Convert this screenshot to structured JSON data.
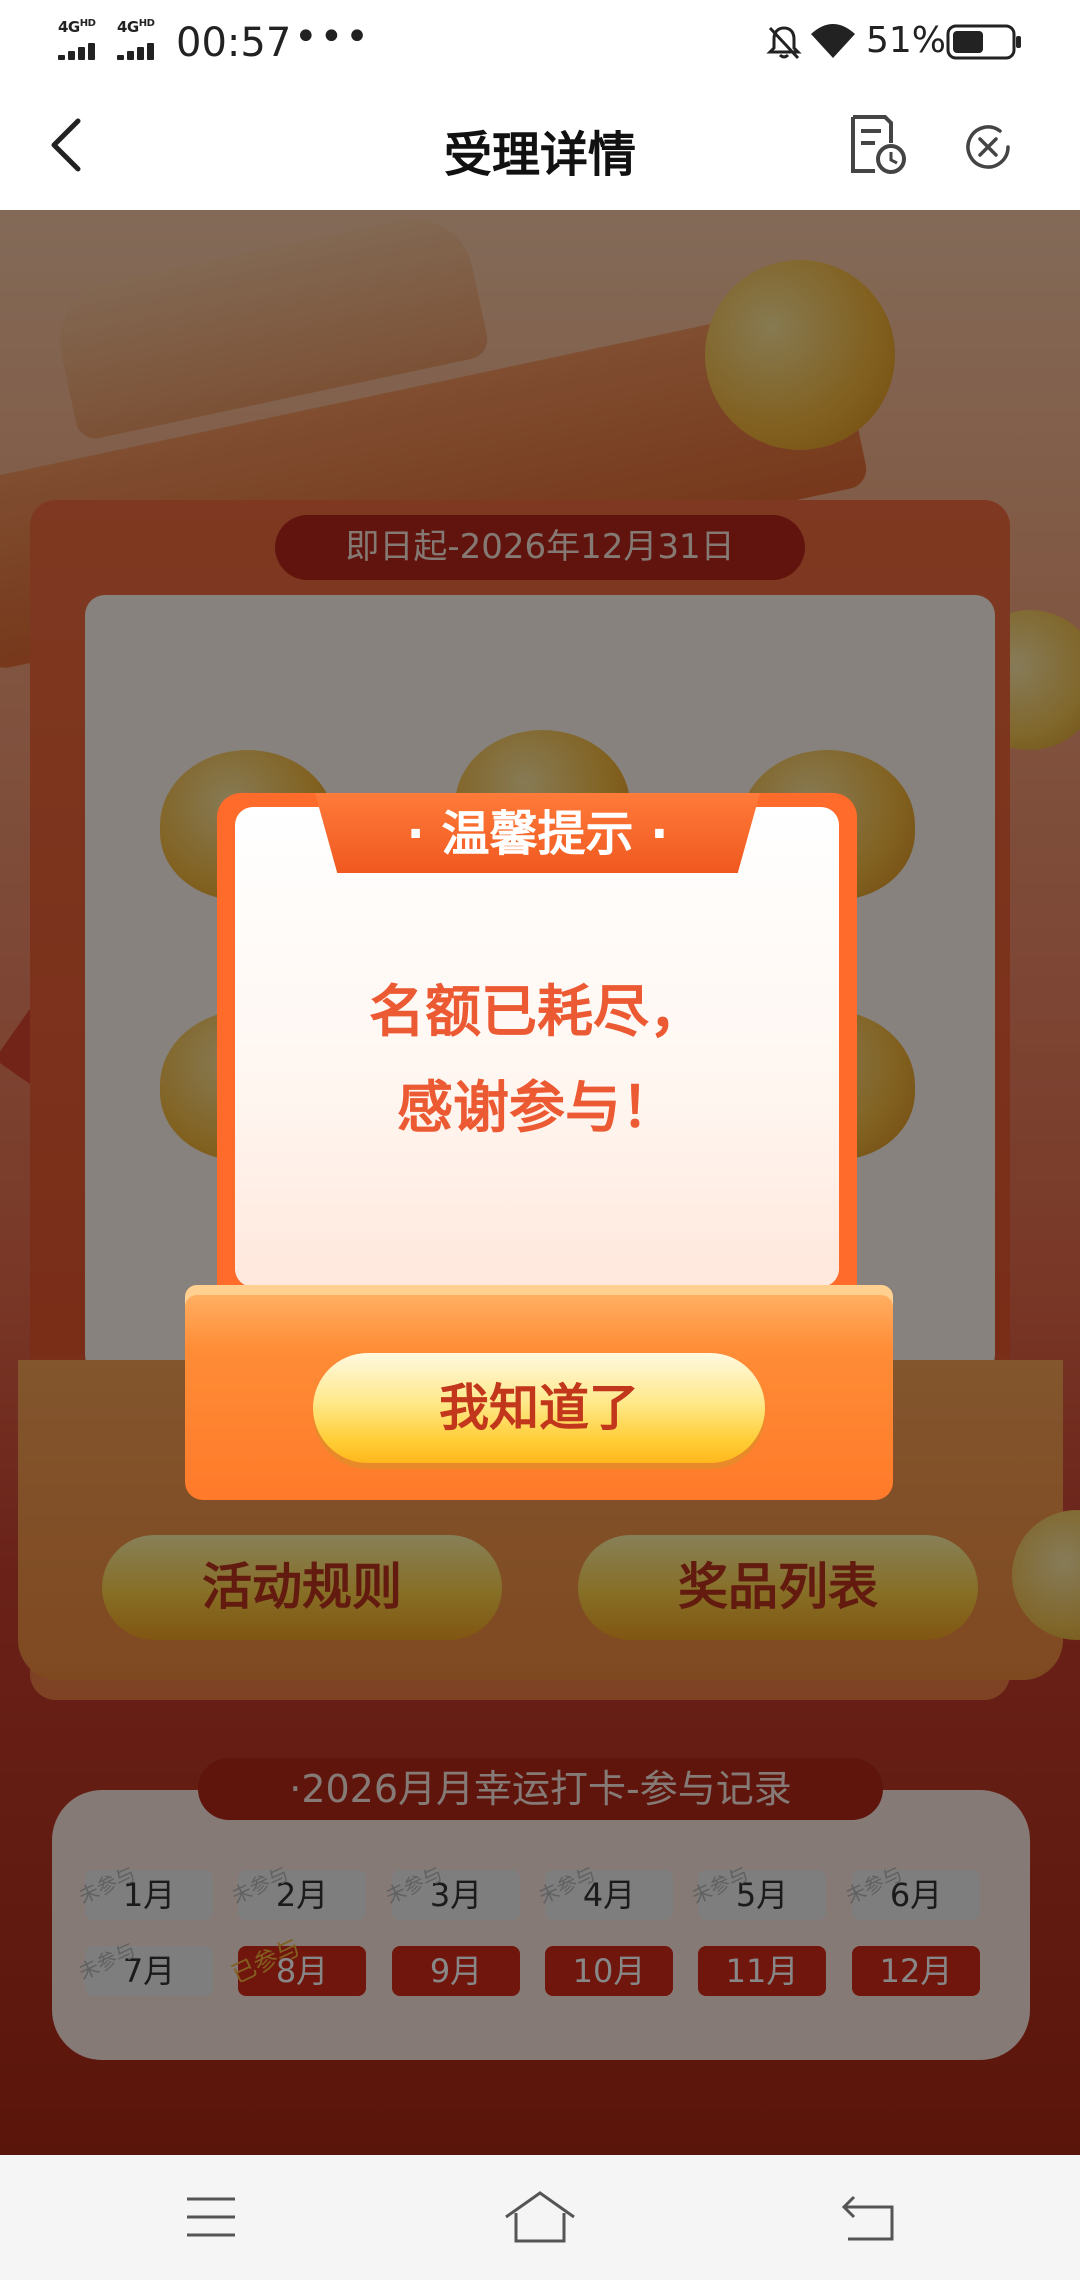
{
  "status_bar": {
    "signal_1": "4G",
    "signal_1_sup": "HD",
    "signal_2": "4G",
    "signal_2_sup": "HD",
    "time": "00:57",
    "more": "•••",
    "battery": "51%",
    "icons": [
      "mute-bell-icon",
      "wifi-icon",
      "battery-icon"
    ]
  },
  "nav": {
    "title": "受理详情",
    "icons": [
      "back-arrow-icon",
      "record-icon",
      "close-icon"
    ]
  },
  "activity": {
    "date_range": "即日起-2026年12月31日",
    "rules_label": "活动规则",
    "prizes_label": "奖品列表"
  },
  "record": {
    "title": "·2026月月幸运打卡-参与记录",
    "months": [
      {
        "label": "1月",
        "stamp": "未参与",
        "active": false
      },
      {
        "label": "2月",
        "stamp": "未参与",
        "active": false
      },
      {
        "label": "3月",
        "stamp": "未参与",
        "active": false
      },
      {
        "label": "4月",
        "stamp": "未参与",
        "active": false
      },
      {
        "label": "5月",
        "stamp": "未参与",
        "active": false
      },
      {
        "label": "6月",
        "stamp": "未参与",
        "active": false
      },
      {
        "label": "7月",
        "stamp": "未参与",
        "active": false
      },
      {
        "label": "8月",
        "stamp": "已参与",
        "active": true
      },
      {
        "label": "9月",
        "stamp": "",
        "active": true
      },
      {
        "label": "10月",
        "stamp": "",
        "active": true
      },
      {
        "label": "11月",
        "stamp": "",
        "active": true
      },
      {
        "label": "12月",
        "stamp": "",
        "active": true
      }
    ]
  },
  "dialog": {
    "title": "· 温馨提示 ·",
    "message_line1": "名额已耗尽，",
    "message_line2": "感谢参与！",
    "button_label": "我知道了"
  },
  "colors": {
    "accent": "#ff6b2a",
    "dialog_text": "#ec5a33",
    "button_text": "#c2361b",
    "month_active": "#d62a19"
  },
  "system_nav": {
    "icons": [
      "menu-icon",
      "home-icon",
      "back-icon"
    ]
  }
}
